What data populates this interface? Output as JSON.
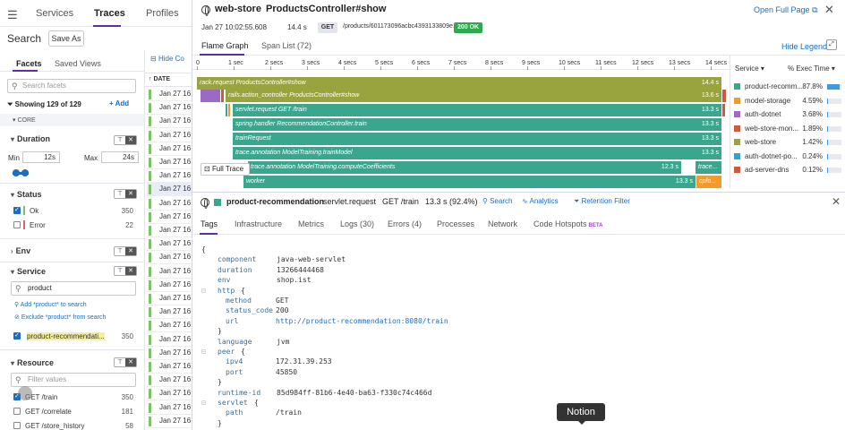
{
  "nav": {
    "services": "Services",
    "traces": "Traces",
    "profiles": "Profiles"
  },
  "search": {
    "title": "Search",
    "save_as": "Save As"
  },
  "facets": {
    "tab_facets": "Facets",
    "tab_saved_views": "Saved Views",
    "search_placeholder": "Search facets",
    "showing": "Showing 129 of 129",
    "add": "Add",
    "core": "CORE",
    "duration": {
      "title": "Duration",
      "min_label": "Min",
      "min_value": "12s",
      "max_label": "Max",
      "max_value": "24s"
    },
    "status": {
      "title": "Status",
      "items": [
        {
          "label": "Ok",
          "count": "350",
          "checked": true,
          "color": "#80c16a"
        },
        {
          "label": "Error",
          "count": "22",
          "checked": false,
          "color": "#e35d6a"
        }
      ]
    },
    "env": {
      "title": "Env"
    },
    "service": {
      "title": "Service",
      "input_value": "product",
      "add_search": "Add *product* to search",
      "exclude_search": "Exclude *product* from search",
      "item": {
        "label": "product-recommendati...",
        "count": "350"
      }
    },
    "resource": {
      "title": "Resource",
      "filter_placeholder": "Filter values",
      "items": [
        {
          "label": "GET /train",
          "count": "350",
          "checked": true
        },
        {
          "label": "GET /correlate",
          "count": "181",
          "checked": false
        },
        {
          "label": "GET /store_history",
          "count": "58",
          "checked": false
        }
      ]
    }
  },
  "tracelist": {
    "hide": "Hide Co",
    "date_header": "DATE",
    "rows": [
      "Jan 27 16",
      "Jan 27 16",
      "Jan 27 16",
      "Jan 27 16",
      "Jan 27 16",
      "Jan 27 16",
      "Jan 27 16",
      "Jan 27 16",
      "Jan 27 16",
      "Jan 27 16",
      "Jan 27 16",
      "Jan 27 16",
      "Jan 27 16",
      "Jan 27 16",
      "Jan 27 16",
      "Jan 27 16",
      "Jan 27 16",
      "Jan 27 16",
      "Jan 27 16",
      "Jan 27 16",
      "Jan 27 16",
      "Jan 27 16",
      "Jan 27 16",
      "Jan 27 16",
      "Jan 27 16"
    ]
  },
  "panel": {
    "service": "web-store",
    "resource": "ProductsController#show",
    "open_full_page": "Open Full Page",
    "timestamp": "Jan 27 10:02:55.608",
    "duration": "14.4 s",
    "method": "GET",
    "url": "/products/601173096acbc4393133809e.json",
    "status": "200 OK",
    "tabs": {
      "flame": "Flame Graph",
      "span_list": "Span List (72)"
    },
    "hide_legend": "Hide Legend",
    "full_trace": "Full Trace",
    "ticks": [
      "0",
      "1 sec",
      "2 secs",
      "3 secs",
      "4 secs",
      "5 secs",
      "6 secs",
      "7 secs",
      "8 secs",
      "9 secs",
      "10 secs",
      "11 secs",
      "12 secs",
      "13 secs",
      "14 secs"
    ],
    "bars": [
      {
        "label": "rack.request ProductsController#show",
        "dur": "14.4 s",
        "color": "#9aa43f"
      },
      {
        "label": "rails.action_controller ProductsController#show",
        "dur": "13.6 s",
        "color": "#9aa43f"
      },
      {
        "label": "servlet.request GET /train",
        "dur": "13.3 s",
        "color": "#3ba58d"
      },
      {
        "label": "spring.handler RecommendationController.train",
        "dur": "13.3 s",
        "color": "#3ba58d"
      },
      {
        "label": "trainRequest",
        "dur": "13.3 s",
        "color": "#3ba58d"
      },
      {
        "label": "trace.annotation ModelTraining.trainModel",
        "dur": "13.3 s",
        "color": "#3ba58d"
      },
      {
        "label": "trace.annotation ModelTraining.computeCoefficients",
        "dur": "12.3 s",
        "color": "#3ba58d"
      },
      {
        "label": "trace...",
        "dur": "",
        "color": "#3ba58d"
      },
      {
        "label": "worker",
        "dur": "13.3 s",
        "color": "#3ba58d"
      },
      {
        "label": "cpfo...",
        "dur": "",
        "color": "#f09b2c"
      }
    ],
    "services_header": {
      "service": "Service",
      "exec": "% Exec Time"
    },
    "services": [
      {
        "name": "product-recomm...",
        "pct": "87.8%",
        "frac": 0.878,
        "color": "#3ba58d"
      },
      {
        "name": "model-storage",
        "pct": "4.59%",
        "frac": 0.0459,
        "color": "#f09b2c"
      },
      {
        "name": "auth-dotnet",
        "pct": "3.68%",
        "frac": 0.0368,
        "color": "#9b6bc4"
      },
      {
        "name": "web-store-mon...",
        "pct": "1.89%",
        "frac": 0.0189,
        "color": "#c95b3f"
      },
      {
        "name": "web-store",
        "pct": "1.42%",
        "frac": 0.0142,
        "color": "#9aa43f"
      },
      {
        "name": "auth-dotnet-po...",
        "pct": "0.24%",
        "frac": 0.0024,
        "color": "#31a4c9"
      },
      {
        "name": "ad-server-dns",
        "pct": "0.12%",
        "frac": 0.0012,
        "color": "#c95b3f"
      }
    ]
  },
  "span": {
    "service": "product-recommendation",
    "op": "servlet.request",
    "resource": "GET /train",
    "duration": "13.3 s (92.4%)",
    "search": "Search",
    "analytics": "Analytics",
    "retention": "Retention Filter",
    "tabs": [
      "Tags",
      "Infrastructure",
      "Metrics",
      "Logs (30)",
      "Errors (4)",
      "Processes",
      "Network",
      "Code Hotspots"
    ],
    "beta": "BETA",
    "code": [
      {
        "t": "{"
      },
      {
        "k": "component",
        "v": "java-web-servlet"
      },
      {
        "k": "duration",
        "v": "13266444468"
      },
      {
        "k": "env",
        "v": "shop.ist"
      },
      {
        "k": "http",
        "v": "{"
      },
      {
        "k": "method",
        "v": "GET"
      },
      {
        "k": "status_code",
        "v": "200"
      },
      {
        "k": "url",
        "v": "http://product-recommendation:8080/train"
      },
      {
        "t": "}"
      },
      {
        "k": "language",
        "v": "jvm"
      },
      {
        "k": "peer",
        "v": "{"
      },
      {
        "k": "ipv4",
        "v": "172.31.39.253"
      },
      {
        "k": "port",
        "v": "45850"
      },
      {
        "t": "}"
      },
      {
        "k": "runtime-id",
        "v": "85d984ff-81b6-4e40-ba63-f330c74c466d"
      },
      {
        "k": "servlet",
        "v": "{"
      },
      {
        "k": "path",
        "v": "/train"
      },
      {
        "t": "}"
      }
    ]
  },
  "tooltip": "Notion"
}
